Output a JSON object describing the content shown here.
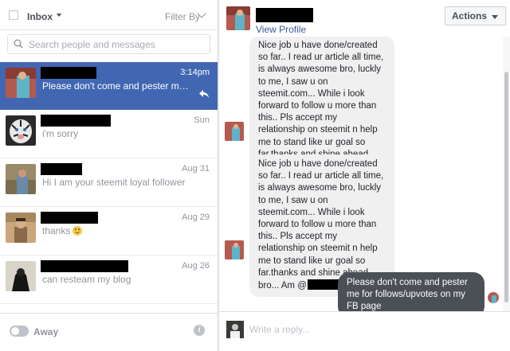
{
  "inbox": {
    "label": "Inbox",
    "filter_label": "Filter By"
  },
  "search": {
    "placeholder": "Search people and messages"
  },
  "threads": [
    {
      "time": "3:14pm",
      "snippet": "Please don't come and pester me for ...",
      "active": true
    },
    {
      "time": "Sun",
      "snippet": "i'm sorry"
    },
    {
      "time": "Aug 31",
      "snippet": "Hi I am your steemit loyal follower"
    },
    {
      "time": "Aug 29",
      "snippet": "thanks"
    },
    {
      "time": "Aug 26",
      "snippet": "can resteam my blog"
    }
  ],
  "status": {
    "label": "Away"
  },
  "conversation": {
    "view_profile": "View Profile",
    "actions_label": "Actions",
    "messages": [
      {
        "from": "them",
        "text": "Nice job u have done/created so far.. I read ur article all time, is always awesome bro, luckly to me, I saw u on steemit.com... While i look forward to follow u more than this.. Pls accept my relationship on steemit n help me to stand like ur goal so far.thanks and shine ahead bro... Am @"
      },
      {
        "from": "them",
        "text": "Nice job u have done/created so far.. I read ur article all time, is always awesome bro, luckly to me, I saw u on steemit.com... While i look forward to follow u more than this.. Pls accept my relationship on steemit n help me to stand like ur goal so far.thanks and shine ahead bro... Am @"
      },
      {
        "from": "me",
        "text": "Please don't come and pester me for follows/upvotes on my FB page"
      }
    ]
  },
  "composer": {
    "placeholder": "Write a reply..."
  },
  "colors": {
    "accent": "#4267b2",
    "outgoing_bubble": "#4b4f56",
    "incoming_bubble": "#f1f0f0",
    "link": "#365899"
  }
}
